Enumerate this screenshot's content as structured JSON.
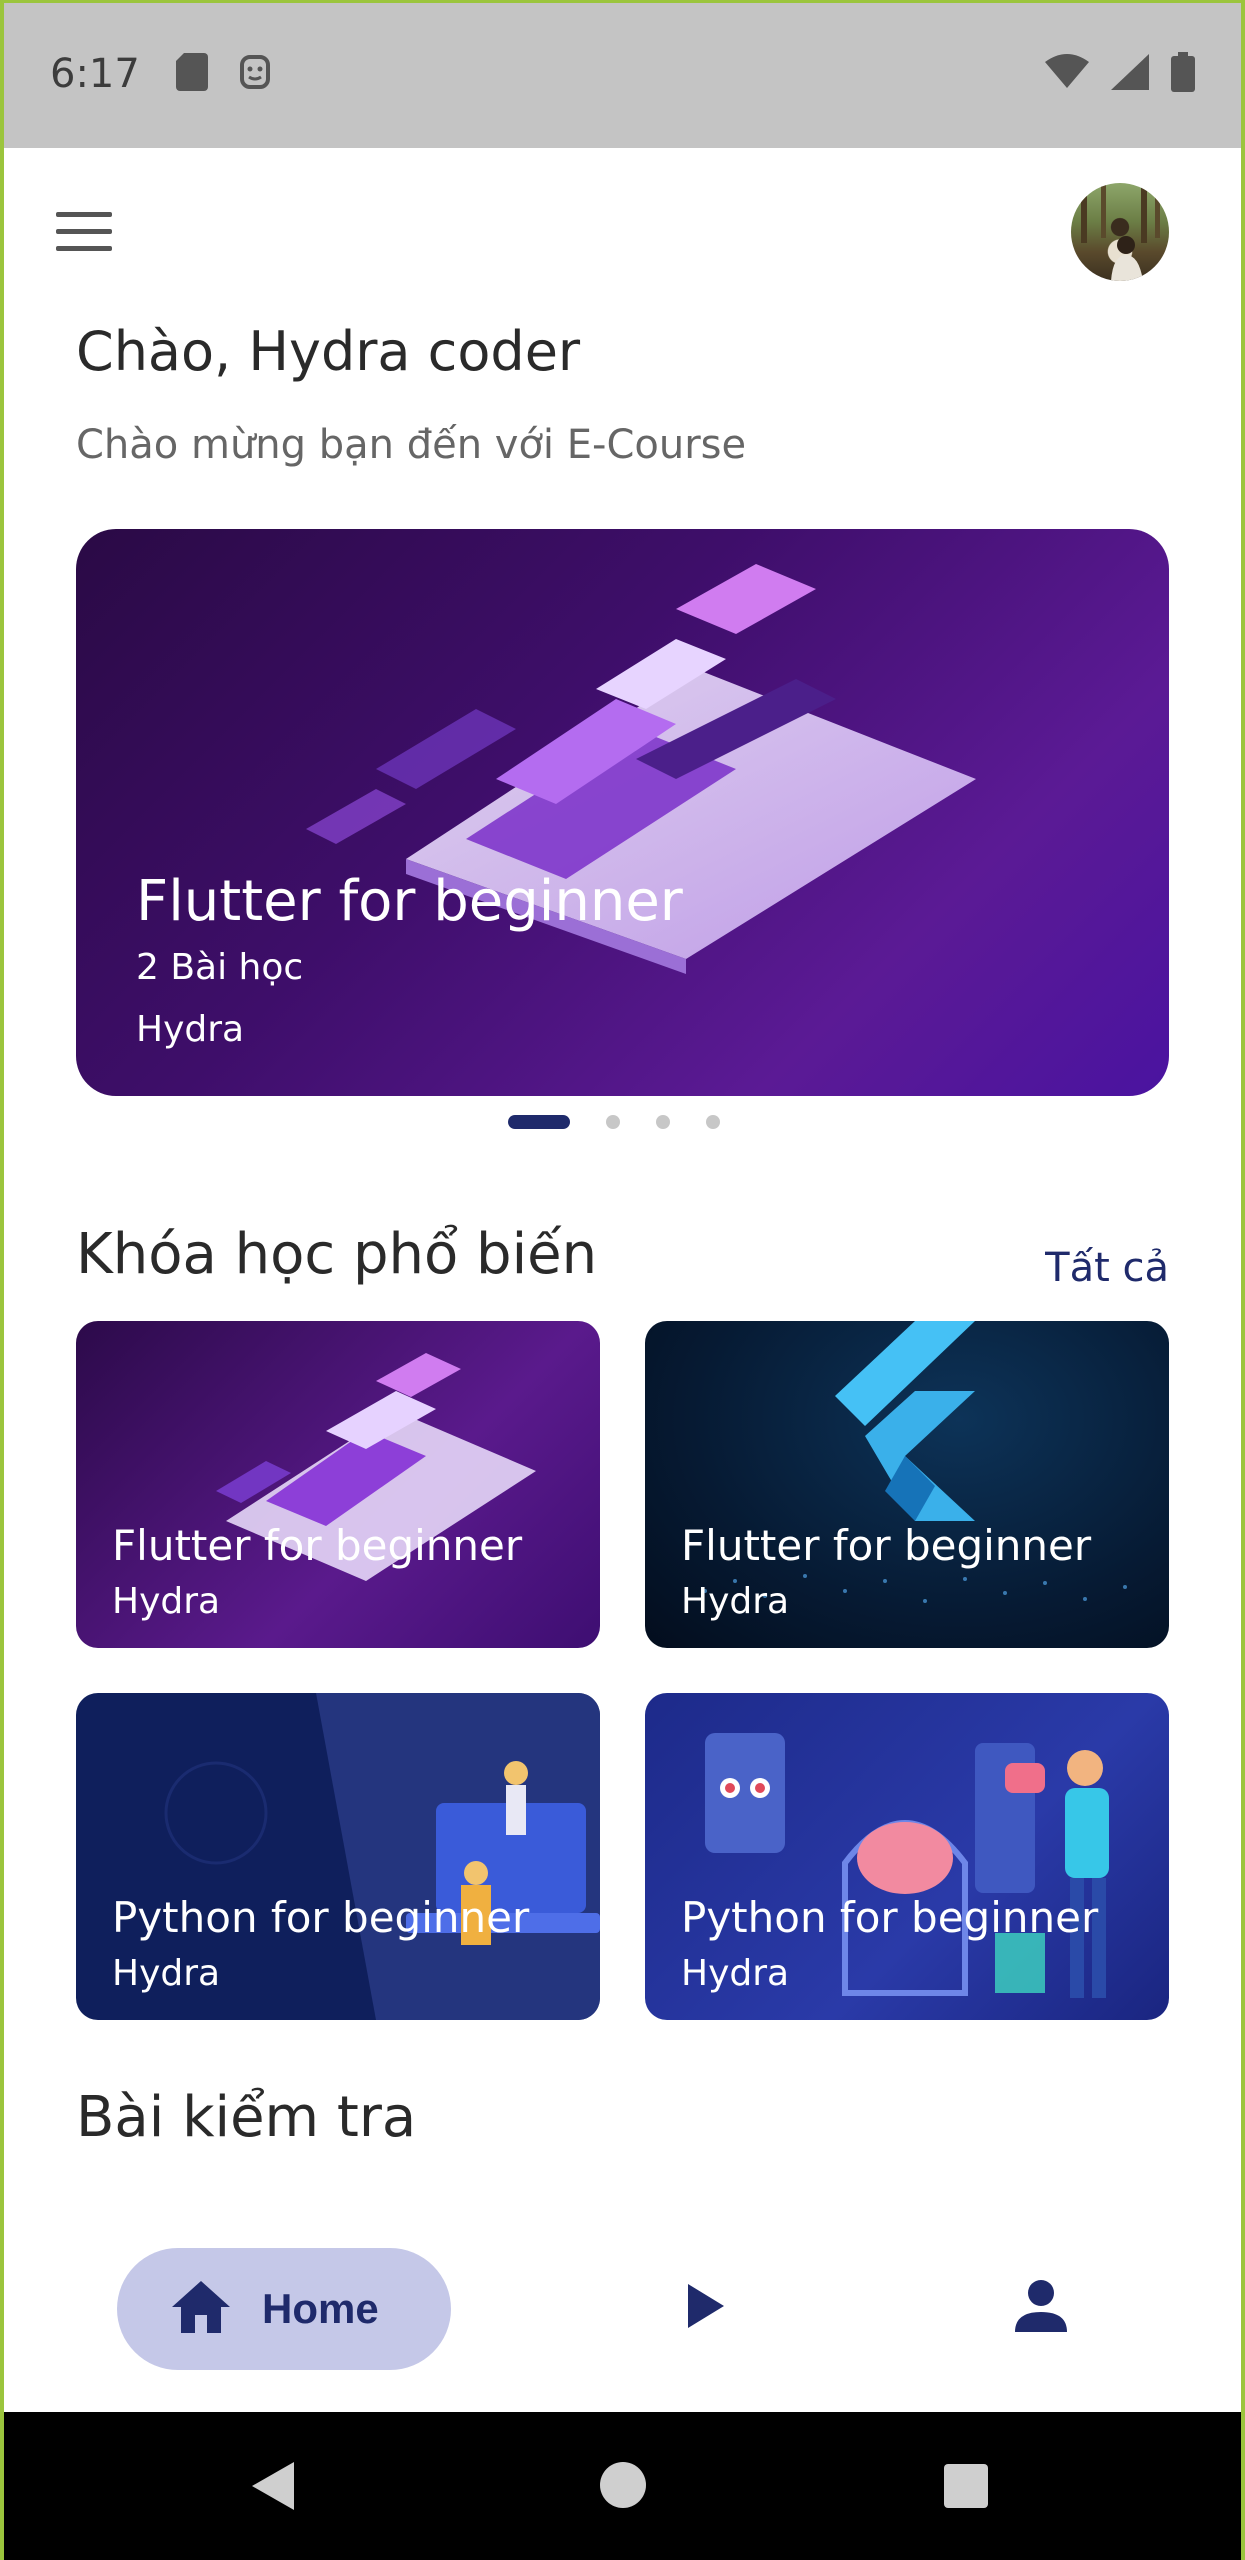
{
  "status_bar": {
    "time": "6:17",
    "left_icons": [
      "sd-card-icon",
      "face-icon"
    ],
    "right_icons": [
      "wifi-icon",
      "signal-icon",
      "battery-icon"
    ]
  },
  "header": {
    "menu_icon": "menu-icon",
    "avatar": "user-avatar"
  },
  "greeting": {
    "title": "Chào, Hydra coder",
    "subtitle": "Chào mừng bạn đến với E-Course"
  },
  "banner": {
    "title": "Flutter for beginner",
    "lessons": "2 Bài học",
    "author": "Hydra",
    "page_count": 4,
    "active_page": 1
  },
  "popular": {
    "title": "Khóa học phổ biến",
    "see_all": "Tất cả",
    "courses": [
      {
        "title": "Flutter for beginner",
        "author": "Hydra"
      },
      {
        "title": "Flutter for beginner",
        "author": "Hydra"
      },
      {
        "title": "Python for beginner",
        "author": "Hydra"
      },
      {
        "title": "Python for beginner",
        "author": "Hydra"
      }
    ]
  },
  "tests": {
    "title": "Bài kiểm tra"
  },
  "bottom_nav": {
    "home_label": "Home",
    "items": [
      "home-icon",
      "play-icon",
      "person-icon"
    ]
  },
  "colors": {
    "accent": "#1f2a6b",
    "nav_pill": "#c5c8e8",
    "status_bar": "#c4c4c4"
  }
}
